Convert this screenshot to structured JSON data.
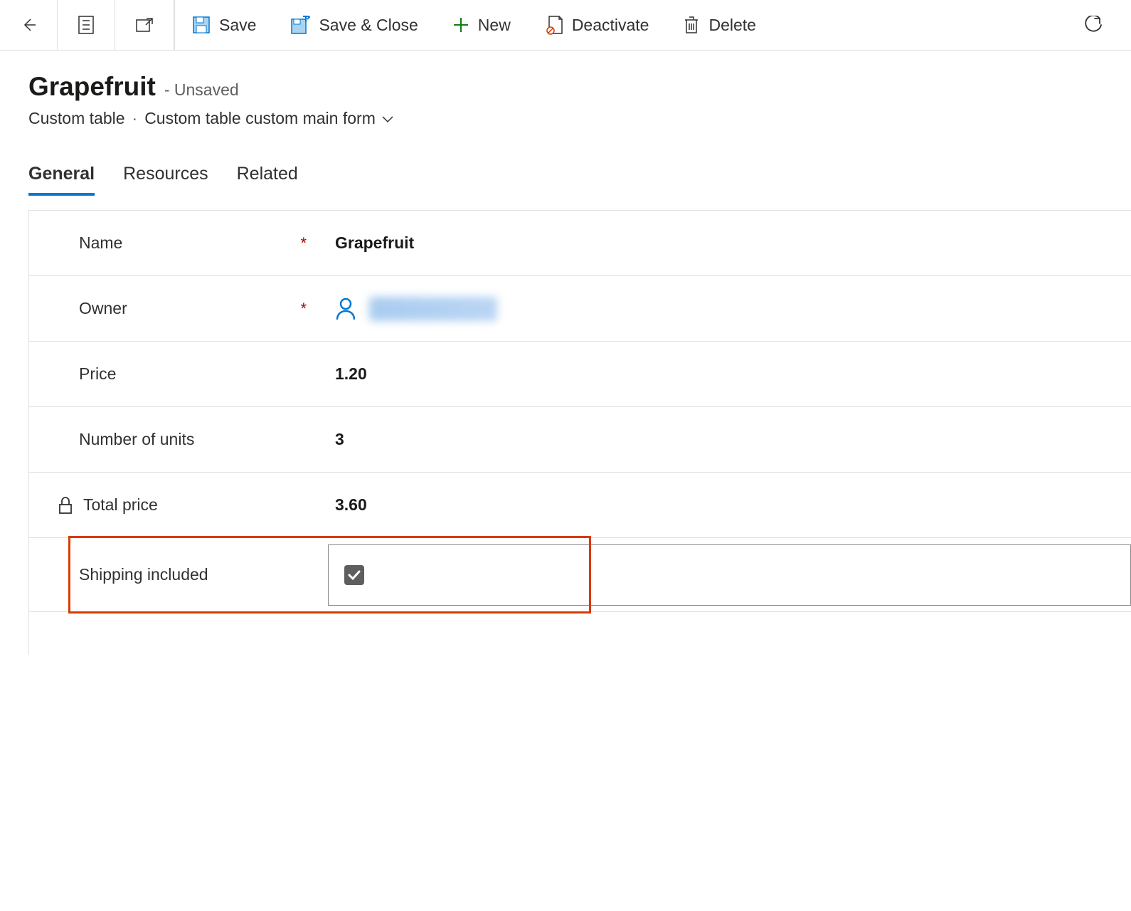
{
  "toolbar": {
    "save": "Save",
    "save_close": "Save & Close",
    "new": "New",
    "deactivate": "Deactivate",
    "delete": "Delete"
  },
  "header": {
    "title": "Grapefruit",
    "status": "- Unsaved",
    "entity": "Custom table",
    "form_name": "Custom table custom main form"
  },
  "tabs": {
    "general": "General",
    "resources": "Resources",
    "related": "Related"
  },
  "form": {
    "name_label": "Name",
    "name_value": "Grapefruit",
    "owner_label": "Owner",
    "price_label": "Price",
    "price_value": "1.20",
    "units_label": "Number of units",
    "units_value": "3",
    "total_label": "Total price",
    "total_value": "3.60",
    "shipping_label": "Shipping included",
    "shipping_checked": true
  }
}
